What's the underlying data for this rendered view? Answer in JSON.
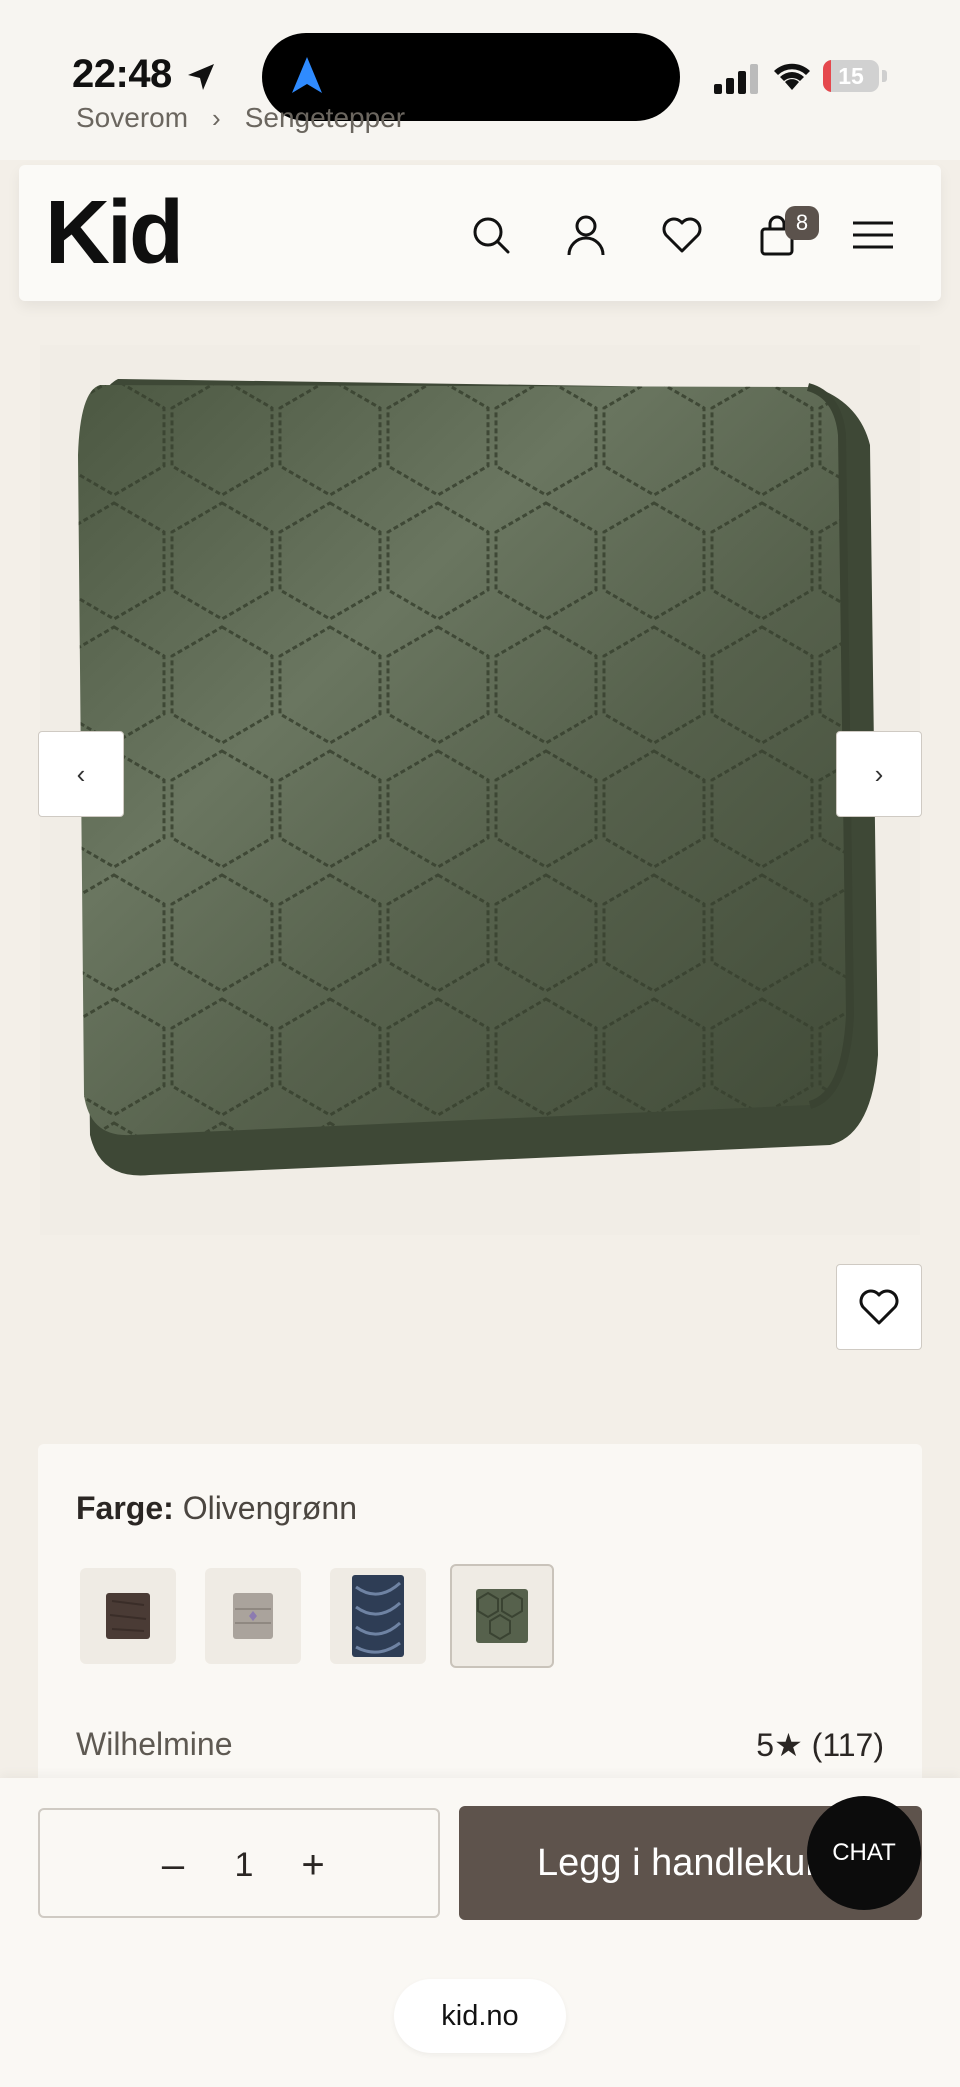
{
  "status_bar": {
    "time": "22:48",
    "battery_level": "15",
    "battery_fraction": 0.15,
    "battery_color": "#e5484d"
  },
  "breadcrumb": {
    "items": [
      "Soverom",
      "Sengetepper"
    ],
    "separator": "›"
  },
  "header": {
    "logo": "Kid",
    "cart_count": "8",
    "icons": [
      "search-icon",
      "account-icon",
      "wishlist-icon",
      "cart-icon",
      "menu-icon"
    ]
  },
  "gallery": {
    "prev_label": "‹",
    "next_label": "›",
    "product_color": "#56614c"
  },
  "product": {
    "color_label": "Farge:",
    "color_value": "Olivengrønn",
    "swatches": [
      {
        "name": "brown",
        "color": "#4a3b35"
      },
      {
        "name": "grey",
        "color": "#aaa39c"
      },
      {
        "name": "blue",
        "color": "#2e3d55"
      },
      {
        "name": "olive",
        "color": "#56614c",
        "selected": true
      }
    ],
    "brand": "Wilhelmine",
    "rating": "5",
    "rating_star": "★",
    "review_count": "(117)"
  },
  "cart_bar": {
    "quantity": "1",
    "minus_label": "–",
    "plus_label": "+",
    "add_to_cart_label": "Legg i handlekurv",
    "chat_label": "CHAT"
  },
  "browser": {
    "url": "kid.no"
  },
  "colors": {
    "background": "#f3efe8",
    "primary_button": "#5e534c",
    "badge": "#5b524c"
  }
}
